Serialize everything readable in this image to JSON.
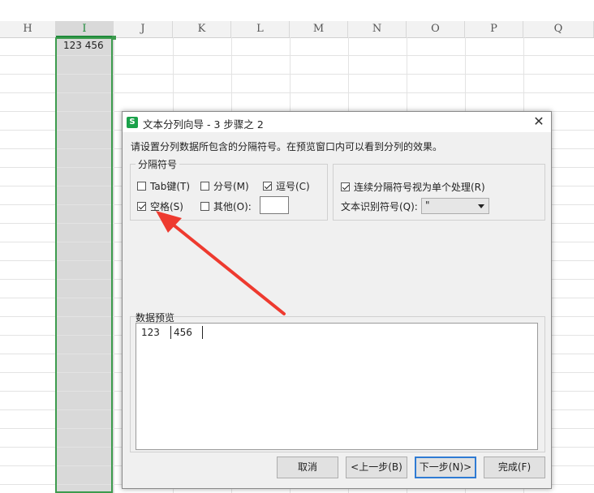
{
  "sheet": {
    "columns": [
      "H",
      "I",
      "J",
      "K",
      "L",
      "M",
      "N",
      "O",
      "P",
      "Q"
    ],
    "selected_column": "I",
    "cell_i1_value": "123 456"
  },
  "dialog": {
    "title": "文本分列向导 - 3 步骤之 2",
    "app_icon_letter": "S",
    "close_glyph": "✕",
    "instruction": "请设置分列数据所包含的分隔符号。在预览窗口内可以看到分列的效果。",
    "delimiters_group_title": "分隔符号",
    "delimiters": [
      {
        "label": "Tab键(T)",
        "checked": false
      },
      {
        "label": "分号(M)",
        "checked": false
      },
      {
        "label": "逗号(C)",
        "checked": true
      },
      {
        "label": "空格(S)",
        "checked": true
      },
      {
        "label": "其他(O):",
        "checked": false
      }
    ],
    "other_delimiter_value": "",
    "consecutive_label": "连续分隔符号视为单个处理(R)",
    "consecutive_checked": true,
    "text_qualifier_label": "文本识别符号(Q):",
    "text_qualifier_value": "\"",
    "preview_label": "数据预览",
    "preview_cells": [
      "123",
      "456"
    ],
    "buttons": {
      "cancel": "取消",
      "back": "<上一步(B)",
      "next": "下一步(N)>",
      "finish": "完成(F)"
    }
  },
  "colors": {
    "accent_green": "#3d9b4e",
    "arrow_red": "#ee3a2f",
    "primary_button_border": "#2f7bd3"
  }
}
